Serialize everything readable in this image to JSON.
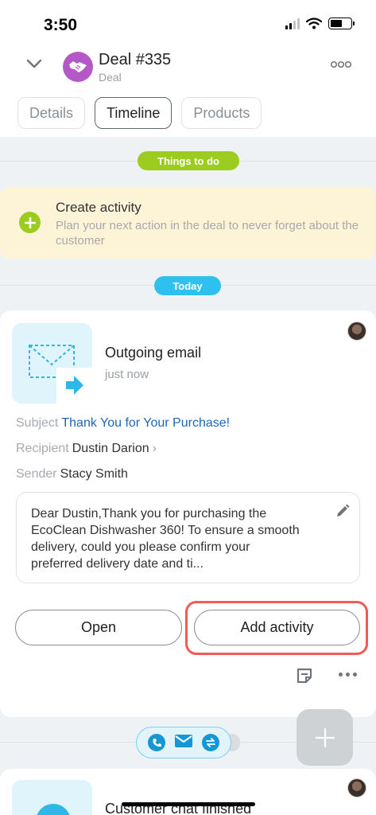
{
  "status_bar": {
    "time": "3:50"
  },
  "header": {
    "title": "Deal #335",
    "subtitle": "Deal"
  },
  "tabs": [
    {
      "label": "Details"
    },
    {
      "label": "Timeline"
    },
    {
      "label": "Products"
    }
  ],
  "things_to_do": {
    "label": "Things to do",
    "create_title": "Create activity",
    "create_desc": "Plan your next action in the deal to never forget about the customer"
  },
  "today": {
    "label": "Today"
  },
  "email": {
    "title": "Outgoing email",
    "time": "just now",
    "subject_label": "Subject",
    "subject": "Thank You for Your Purchase!",
    "recipient_label": "Recipient",
    "recipient": "Dustin Darion",
    "sender_label": "Sender",
    "sender": "Stacy Smith",
    "body": "Dear Dustin,Thank you for purchasing the EcoClean Dishwasher 360! To ensure a smooth delivery, could you please confirm your preferred delivery date and ti..."
  },
  "buttons": {
    "open": "Open",
    "add_activity": "Add activity"
  },
  "next_item": {
    "title": "Customer chat finished"
  },
  "colors": {
    "accent_green": "#9ccc20",
    "today_blue": "#2fc0ef",
    "highlight_red": "#f25a55",
    "link_blue": "#2067b0",
    "avatar_purple": "#b458c8"
  },
  "icons": [
    "chevron-down-icon",
    "handshake-icon",
    "more-icon",
    "plus-icon",
    "email-icon",
    "pencil-icon",
    "note-icon",
    "phone-icon",
    "mail-icon",
    "sync-icon",
    "add-icon"
  ]
}
